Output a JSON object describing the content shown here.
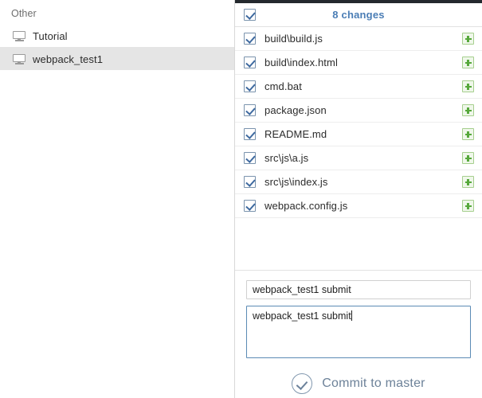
{
  "sidebar": {
    "group_label": "Other",
    "items": [
      {
        "label": "Tutorial",
        "icon": "monitor-icon",
        "selected": false
      },
      {
        "label": "webpack_test1",
        "icon": "monitor-icon",
        "selected": true
      }
    ]
  },
  "changes_panel": {
    "header": {
      "title": "8 changes",
      "select_all_checked": true,
      "title_color": "#4a7db5"
    },
    "files": [
      {
        "name": "build\\build.js",
        "checked": true,
        "status": "added"
      },
      {
        "name": "build\\index.html",
        "checked": true,
        "status": "added"
      },
      {
        "name": "cmd.bat",
        "checked": true,
        "status": "added"
      },
      {
        "name": "package.json",
        "checked": true,
        "status": "added"
      },
      {
        "name": "README.md",
        "checked": true,
        "status": "added"
      },
      {
        "name": "src\\js\\a.js",
        "checked": true,
        "status": "added"
      },
      {
        "name": "src\\js\\index.js",
        "checked": true,
        "status": "added"
      },
      {
        "name": "webpack.config.js",
        "checked": true,
        "status": "added"
      }
    ],
    "commit": {
      "summary_value": "webpack_test1 submit",
      "summary_placeholder": "Summary",
      "description_value": "webpack_test1 submit",
      "description_placeholder": "Description",
      "button_label": "Commit to master",
      "button_icon": "check-circle-icon",
      "button_color": "#6d8299"
    }
  },
  "colors": {
    "accent_blue": "#4a7db5",
    "added_green": "#56a83b",
    "selection_gray": "#e5e5e5",
    "focus_border": "#5b8bb5",
    "topbar_dark": "#24292e"
  }
}
